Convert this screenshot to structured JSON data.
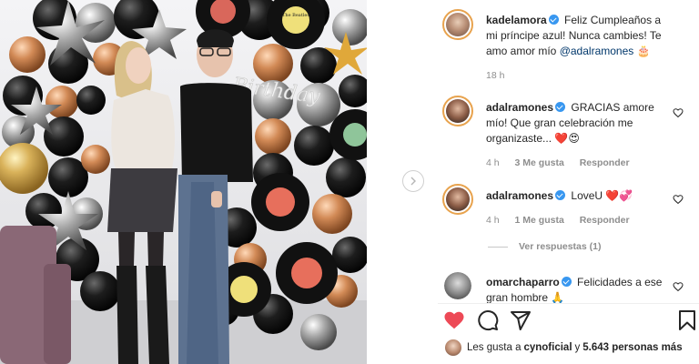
{
  "caption": {
    "username": "kadelamora",
    "text": "Feliz Cumpleaños a mi príncipe azul! Nunca cambies! Te amo amor mío",
    "mention": "@adalramones",
    "emoji": "🎂",
    "time": "18 h"
  },
  "comments": [
    {
      "username": "adalramones",
      "text": "GRACIAS amore mío! Que gran celebración me organizaste... ❤️😍",
      "time": "4 h",
      "likes": "3 Me gusta",
      "reply": "Responder"
    },
    {
      "username": "adalramones",
      "text": "LoveU ❤️💞",
      "time": "4 h",
      "likes": "1 Me gusta",
      "reply": "Responder",
      "view_replies": "Ver respuestas (1)"
    },
    {
      "username": "omarchaparro",
      "text": "Felicidades a ese gran hombre 🙏"
    }
  ],
  "likes_line": {
    "prefix": "Les gusta a",
    "user": "cynoficial",
    "middle": "y",
    "count": "5.643 personas más"
  },
  "photo": {
    "balloon_text": "Birthday",
    "record_label": "The Beatles"
  },
  "icons": [
    "heart-filled-icon",
    "comment-icon",
    "share-icon",
    "bookmark-icon",
    "small-heart-icon",
    "chevron-right-icon",
    "verified-badge-icon"
  ],
  "colors": {
    "heart": "#ed4956",
    "verified": "#3897f0",
    "mention": "#00376b",
    "meta": "#8e8e8e"
  }
}
